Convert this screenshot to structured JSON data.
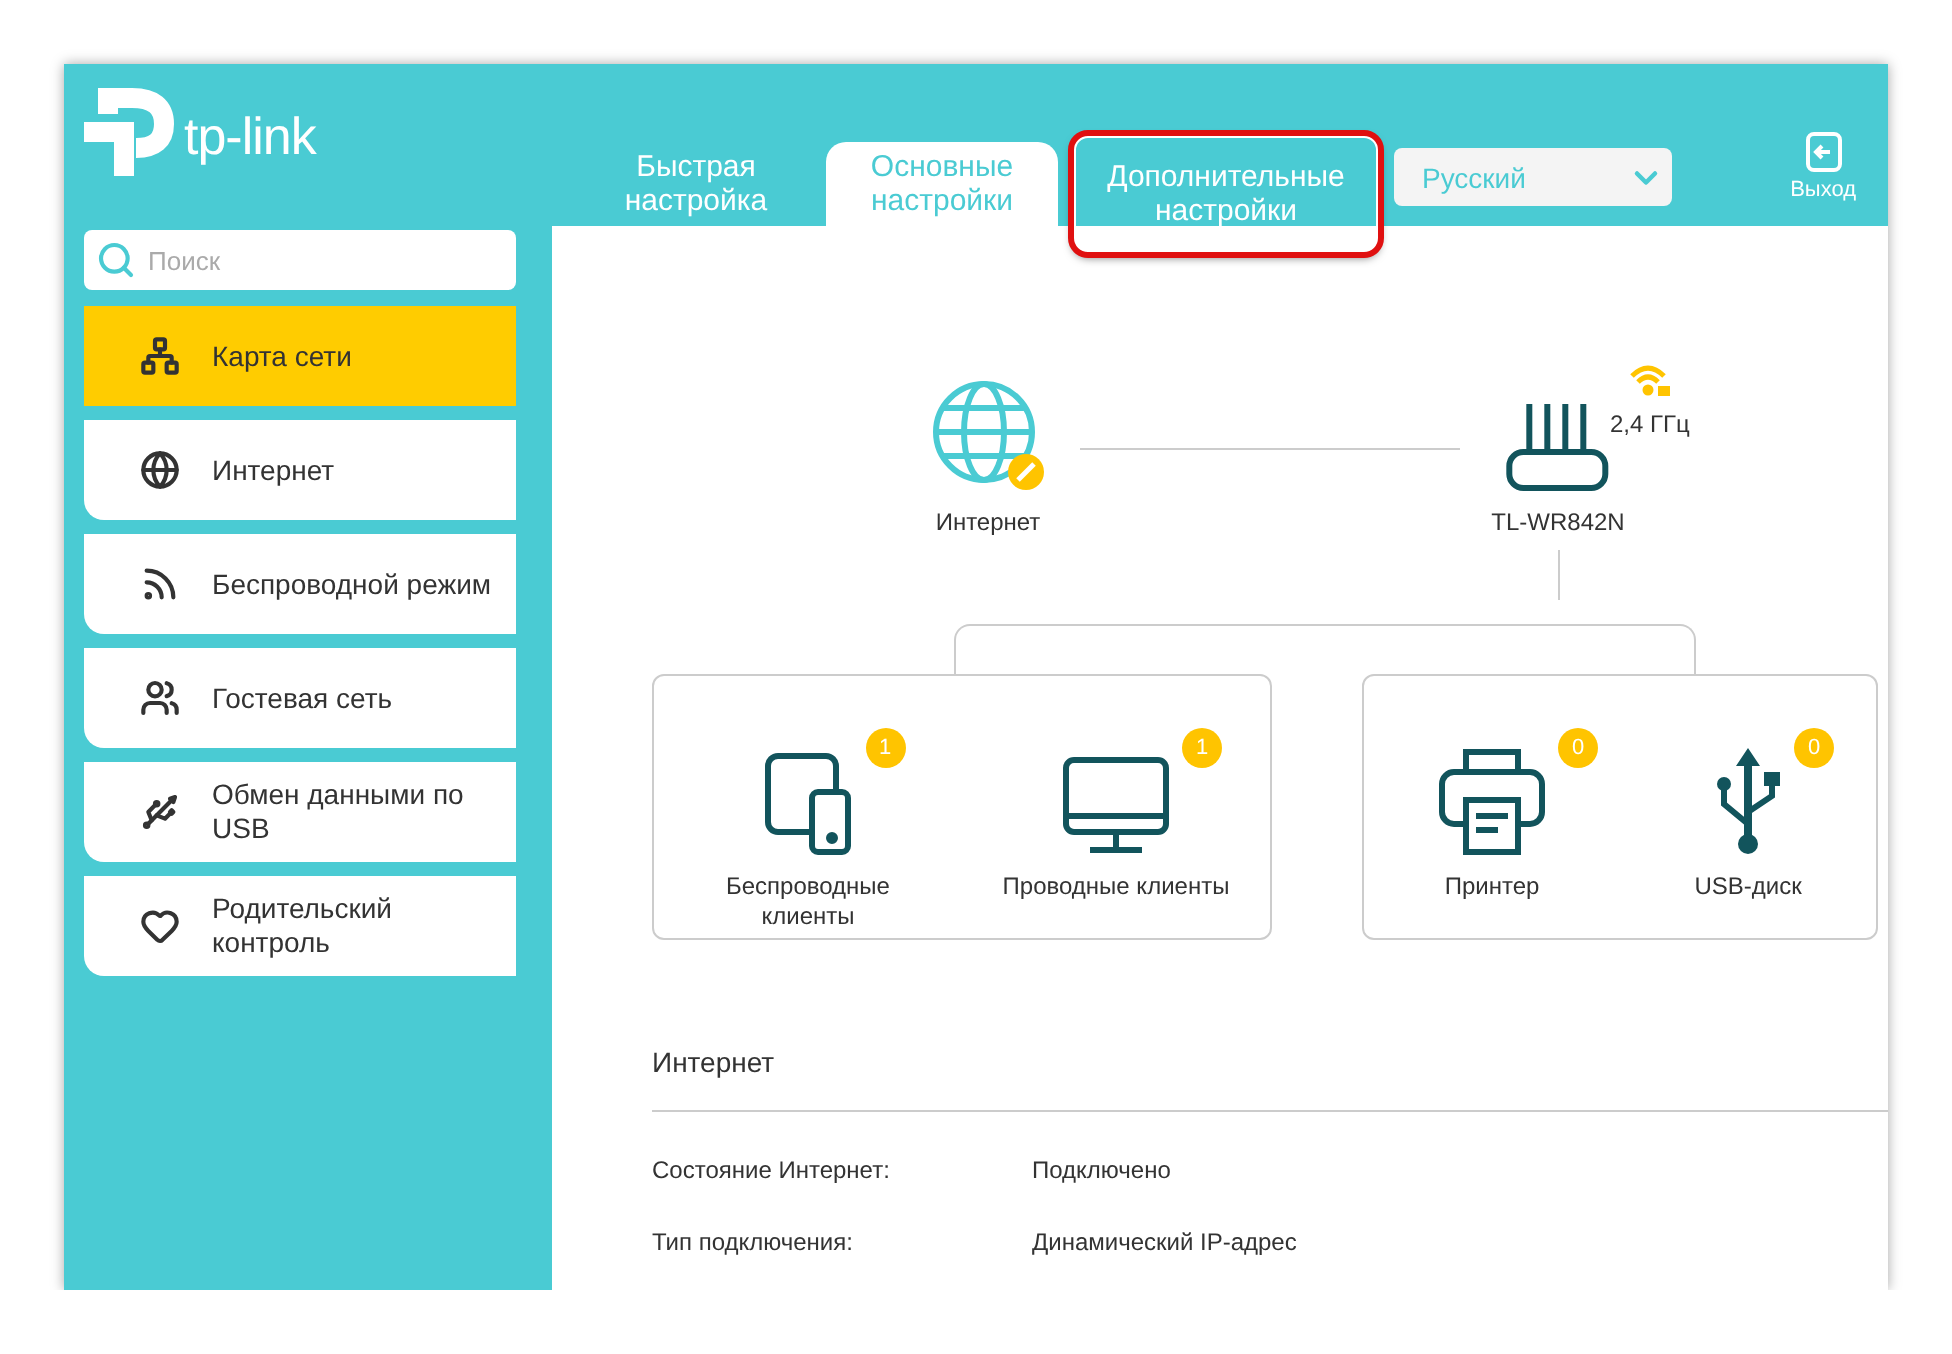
{
  "logo": {
    "text": "tp-link"
  },
  "tabs": [
    {
      "label": "Быстрая настройка",
      "selected": false,
      "highlighted": false
    },
    {
      "label": "Основные настройки",
      "selected": true,
      "highlighted": false
    },
    {
      "label": "Дополнительные настройки",
      "selected": false,
      "highlighted": true
    }
  ],
  "language": {
    "value": "Русский"
  },
  "exit": {
    "label": "Выход"
  },
  "search": {
    "placeholder": "Поиск"
  },
  "sidebar": {
    "items": [
      {
        "label": "Карта сети",
        "selected": true
      },
      {
        "label": "Интернет",
        "selected": false
      },
      {
        "label": "Беспроводной режим",
        "selected": false
      },
      {
        "label": "Гостевая сеть",
        "selected": false
      },
      {
        "label": "Обмен данными по USB",
        "selected": false
      },
      {
        "label": "Родительский контроль",
        "selected": false
      }
    ]
  },
  "network_map": {
    "internet": {
      "label": "Интернет"
    },
    "router": {
      "label": "TL-WR842N",
      "band": "2,4 ГГц"
    },
    "groups": [
      {
        "clients": [
          {
            "label": "Беспроводные клиенты",
            "count": "1"
          },
          {
            "label": "Проводные клиенты",
            "count": "1"
          }
        ]
      },
      {
        "clients": [
          {
            "label": "Принтер",
            "count": "0"
          },
          {
            "label": "USB-диск",
            "count": "0"
          }
        ]
      }
    ]
  },
  "internet_info": {
    "title": "Интернет",
    "rows": [
      {
        "label": "Состояние Интернет:",
        "value": "Подключено"
      },
      {
        "label": "Тип подключения:",
        "value": "Динамический IP-адрес"
      }
    ]
  }
}
